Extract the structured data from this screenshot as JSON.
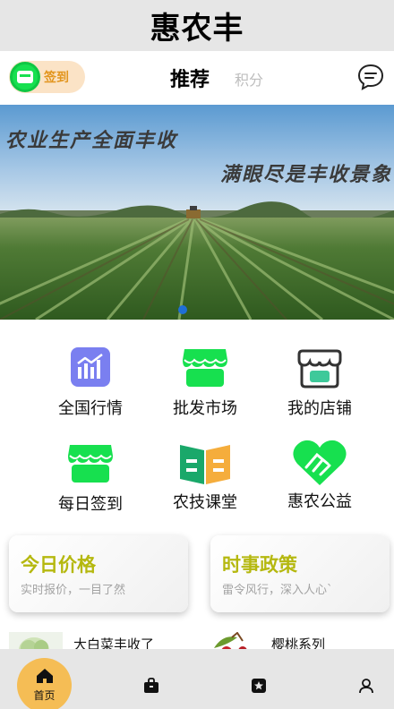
{
  "app": {
    "title": "惠农丰"
  },
  "top_nav": {
    "checkin_label": "签到",
    "tabs": [
      {
        "label": "推荐",
        "active": true
      },
      {
        "label": "积分",
        "active": false
      }
    ],
    "icons": {
      "checkin": "calendar-badge-icon",
      "message": "chat-bubble-icon"
    }
  },
  "banner": {
    "line1": "农业生产全面丰收",
    "line2": "满眼尽是丰收景象",
    "slide_count": 1,
    "active_slide": 1
  },
  "grid_menu": [
    {
      "label": "全国行情",
      "icon": "bar-chart-icon"
    },
    {
      "label": "批发市场",
      "icon": "storefront-icon"
    },
    {
      "label": "我的店铺",
      "icon": "my-shop-icon"
    },
    {
      "label": "每日签到",
      "icon": "storefront-icon"
    },
    {
      "label": "农技课堂",
      "icon": "open-book-icon"
    },
    {
      "label": "惠农公益",
      "icon": "heart-hands-icon"
    }
  ],
  "cards": [
    {
      "title": "今日价格",
      "subtitle": "实时报价，一目了然"
    },
    {
      "title": "时事政策",
      "subtitle": "雷令风行，深入人心`"
    }
  ],
  "news": [
    {
      "title": "大白菜丰收了",
      "thumb": "cabbage-thumbnail"
    },
    {
      "title": "樱桃系列",
      "thumb": "cherry-thumbnail"
    }
  ],
  "tab_bar": {
    "home_label": "首页",
    "items": [
      "home-icon",
      "bag-icon",
      "star-icon",
      "user-icon"
    ]
  },
  "colors": {
    "accent_green": "#17e04f",
    "card_title": "#b5b80f",
    "home_tab": "#f5bd55",
    "checkin_bg": "#fbe3c6",
    "checkin_text": "#e2951e"
  }
}
